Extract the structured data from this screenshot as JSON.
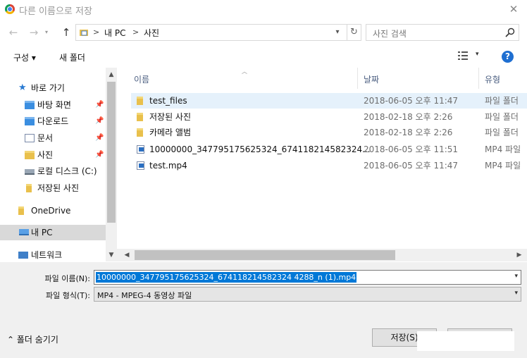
{
  "window": {
    "title": "다른 이름으로 저장",
    "close_glyph": "✕"
  },
  "nav": {
    "back": "←",
    "forward": "→",
    "up": "↑",
    "breadcrumb": [
      "내 PC",
      "사진"
    ],
    "search_placeholder": "사진 검색"
  },
  "toolbar": {
    "organize_label": "구성 ▾",
    "new_folder_label": "새 폴더",
    "help": "?"
  },
  "sidebar": {
    "items": [
      {
        "label": "바로 가기",
        "icon": "star-icon",
        "pinned": false
      },
      {
        "label": "바탕 화면",
        "icon": "desktop-folder-icon",
        "pinned": true
      },
      {
        "label": "다운로드",
        "icon": "download-folder-icon",
        "pinned": true
      },
      {
        "label": "문서",
        "icon": "documents-folder-icon",
        "pinned": true
      },
      {
        "label": "사진",
        "icon": "pictures-folder-icon",
        "pinned": true
      },
      {
        "label": "로컬 디스크 (C:)",
        "icon": "drive-icon",
        "pinned": false
      },
      {
        "label": "저장된 사진",
        "icon": "folder-icon",
        "pinned": false
      },
      {
        "label": "OneDrive",
        "icon": "onedrive-icon",
        "pinned": false
      },
      {
        "label": "내 PC",
        "icon": "pc-icon",
        "pinned": false,
        "selected": true
      },
      {
        "label": "네트워크",
        "icon": "network-icon",
        "pinned": false
      }
    ]
  },
  "columns": {
    "name": "이름",
    "date": "날짜",
    "type": "유형"
  },
  "files": [
    {
      "name": "test_files",
      "date": "2018-06-05 오후 11:47",
      "type": "파일 폴더",
      "kind": "folder",
      "highlighted": true
    },
    {
      "name": "저장된 사진",
      "date": "2018-02-18 오후 2:26",
      "type": "파일 폴더",
      "kind": "folder"
    },
    {
      "name": "카메라 앨범",
      "date": "2018-02-18 오후 2:26",
      "type": "파일 폴더",
      "kind": "folder"
    },
    {
      "name": "10000000_347795175625324_674118214582324...",
      "date": "2018-06-05 오후 11:51",
      "type": "MP4 파일",
      "kind": "mp4"
    },
    {
      "name": "test.mp4",
      "date": "2018-06-05 오후 11:47",
      "type": "MP4 파일",
      "kind": "mp4"
    }
  ],
  "form": {
    "filename_label": "파일 이름(N):",
    "filename_value": "10000000_347795175625324_674118214582324 4288_n (1).mp4",
    "filetype_label": "파일 형식(T):",
    "filetype_value": "MP4 - MPEG-4 동영상 파일"
  },
  "footer": {
    "hide_folders_label": "⌃ 폴더 숨기기",
    "save_label": "저장(S)"
  }
}
